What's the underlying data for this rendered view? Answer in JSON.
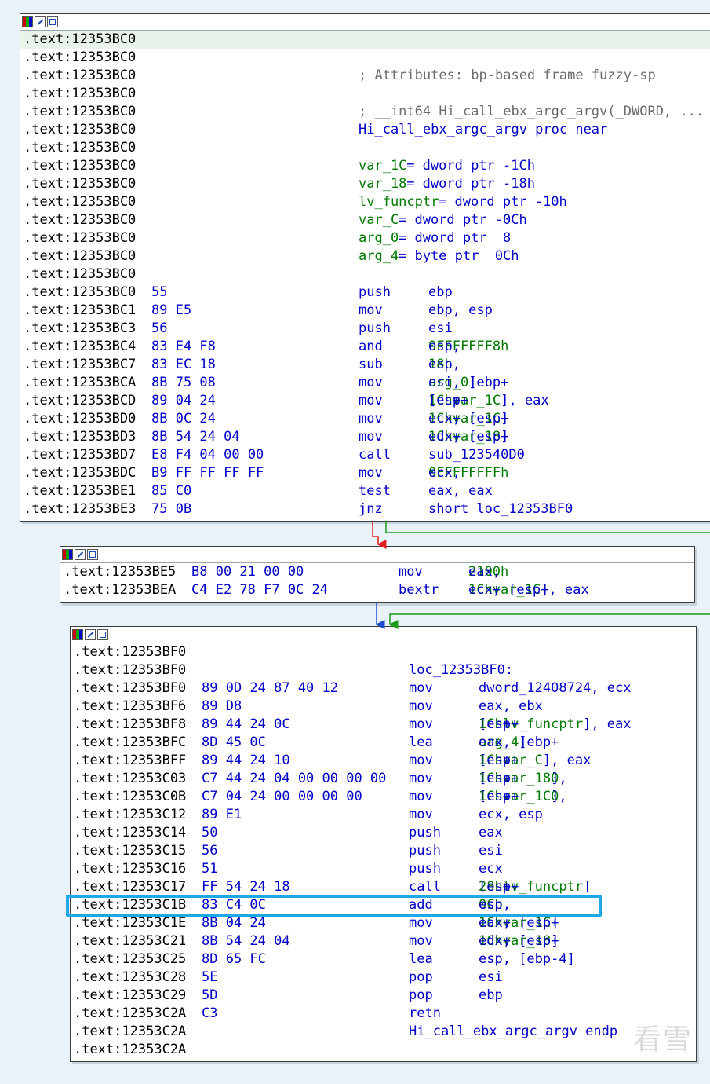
{
  "blocks": [
    {
      "id": "block1",
      "lines": [
        {
          "addr": ".text:12353BC0"
        },
        {
          "addr": ".text:12353BC0"
        },
        {
          "addr": ".text:12353BC0",
          "comment": "; Attributes: bp-based frame fuzzy-sp"
        },
        {
          "addr": ".text:12353BC0"
        },
        {
          "addr": ".text:12353BC0",
          "comment": "; __int64 Hi_call_ebx_argc_argv(_DWORD, ..."
        },
        {
          "addr": ".text:12353BC0",
          "label": "Hi_call_ebx_argc_argv proc near"
        },
        {
          "addr": ".text:12353BC0"
        },
        {
          "addr": ".text:12353BC0",
          "var": "var_1C",
          "vardef": "= dword ptr -1Ch"
        },
        {
          "addr": ".text:12353BC0",
          "var": "var_18",
          "vardef": "= dword ptr -18h"
        },
        {
          "addr": ".text:12353BC0",
          "var": "lv_funcptr",
          "vardef": "= dword ptr -10h"
        },
        {
          "addr": ".text:12353BC0",
          "var": "var_C",
          "vardef": "= dword ptr -0Ch"
        },
        {
          "addr": ".text:12353BC0",
          "var": "arg_0",
          "vardef": "= dword ptr  8"
        },
        {
          "addr": ".text:12353BC0",
          "var": "arg_4",
          "vardef": "= byte ptr  0Ch"
        },
        {
          "addr": ".text:12353BC0"
        },
        {
          "addr": ".text:12353BC0",
          "bytes": "55",
          "mnem": "push",
          "ops": [
            [
              "ebp",
              0
            ]
          ]
        },
        {
          "addr": ".text:12353BC1",
          "bytes": "89 E5",
          "mnem": "mov",
          "ops": [
            [
              "ebp, esp",
              0
            ]
          ]
        },
        {
          "addr": ".text:12353BC3",
          "bytes": "56",
          "mnem": "push",
          "ops": [
            [
              "esi",
              0
            ]
          ]
        },
        {
          "addr": ".text:12353BC4",
          "bytes": "83 E4 F8",
          "mnem": "and",
          "ops": [
            [
              "esp, ",
              0
            ],
            [
              "0FFFFFFF8h",
              1
            ]
          ]
        },
        {
          "addr": ".text:12353BC7",
          "bytes": "83 EC 18",
          "mnem": "sub",
          "ops": [
            [
              "esp, ",
              0
            ],
            [
              "18h",
              1
            ]
          ]
        },
        {
          "addr": ".text:12353BCA",
          "bytes": "8B 75 08",
          "mnem": "mov",
          "ops": [
            [
              "esi, [ebp+",
              0
            ],
            [
              "arg_0",
              1
            ],
            [
              "]",
              0
            ]
          ]
        },
        {
          "addr": ".text:12353BCD",
          "bytes": "89 04 24",
          "mnem": "mov",
          "ops": [
            [
              "[esp+",
              0
            ],
            [
              "1Ch",
              1
            ],
            [
              "+",
              0
            ],
            [
              "var_1C",
              1
            ],
            [
              "], eax",
              0
            ]
          ]
        },
        {
          "addr": ".text:12353BD0",
          "bytes": "8B 0C 24",
          "mnem": "mov",
          "ops": [
            [
              "ecx, [esp+",
              0
            ],
            [
              "1Ch",
              1
            ],
            [
              "+",
              0
            ],
            [
              "var_1C",
              1
            ],
            [
              "]",
              0
            ]
          ]
        },
        {
          "addr": ".text:12353BD3",
          "bytes": "8B 54 24 04",
          "mnem": "mov",
          "ops": [
            [
              "edx, [esp+",
              0
            ],
            [
              "1Ch",
              1
            ],
            [
              "+",
              0
            ],
            [
              "var_18",
              1
            ],
            [
              "]",
              0
            ]
          ]
        },
        {
          "addr": ".text:12353BD7",
          "bytes": "E8 F4 04 00 00",
          "mnem": "call",
          "ops": [
            [
              "sub_123540D0",
              0
            ]
          ]
        },
        {
          "addr": ".text:12353BDC",
          "bytes": "B9 FF FF FF FF",
          "mnem": "mov",
          "ops": [
            [
              "ecx, ",
              0
            ],
            [
              "0FFFFFFFFh",
              1
            ]
          ]
        },
        {
          "addr": ".text:12353BE1",
          "bytes": "85 C0",
          "mnem": "test",
          "ops": [
            [
              "eax, eax",
              0
            ]
          ]
        },
        {
          "addr": ".text:12353BE3",
          "bytes": "75 0B",
          "mnem": "jnz",
          "ops": [
            [
              "short loc_12353BF0",
              0
            ]
          ]
        }
      ]
    },
    {
      "id": "block2",
      "lines": [
        {
          "addr": ".text:12353BE5",
          "bytes": "B8 00 21 00 00",
          "mnem": "mov",
          "ops": [
            [
              "eax, ",
              0
            ],
            [
              "2100h",
              1
            ]
          ]
        },
        {
          "addr": ".text:12353BEA",
          "bytes": "C4 E2 78 F7 0C 24",
          "mnem": "bextr",
          "ops": [
            [
              "ecx, [esp+",
              0
            ],
            [
              "1Ch",
              1
            ],
            [
              "+",
              0
            ],
            [
              "var_1C",
              1
            ],
            [
              "], eax",
              0
            ]
          ]
        }
      ]
    },
    {
      "id": "block3",
      "lines": [
        {
          "addr": ".text:12353BF0"
        },
        {
          "addr": ".text:12353BF0",
          "label": "loc_12353BF0:"
        },
        {
          "addr": ".text:12353BF0",
          "bytes": "89 0D 24 87 40 12",
          "mnem": "mov",
          "ops": [
            [
              "dword_12408724, ecx",
              0
            ]
          ]
        },
        {
          "addr": ".text:12353BF6",
          "bytes": "89 D8",
          "mnem": "mov",
          "ops": [
            [
              "eax, ebx",
              0
            ]
          ]
        },
        {
          "addr": ".text:12353BF8",
          "bytes": "89 44 24 0C",
          "mnem": "mov",
          "ops": [
            [
              "[esp+",
              0
            ],
            [
              "1Ch",
              1
            ],
            [
              "+",
              0
            ],
            [
              "lv_funcptr",
              1
            ],
            [
              "], eax",
              0
            ]
          ]
        },
        {
          "addr": ".text:12353BFC",
          "bytes": "8D 45 0C",
          "mnem": "lea",
          "ops": [
            [
              "eax, [ebp+",
              0
            ],
            [
              "arg_4",
              1
            ],
            [
              "]",
              0
            ]
          ]
        },
        {
          "addr": ".text:12353BFF",
          "bytes": "89 44 24 10",
          "mnem": "mov",
          "ops": [
            [
              "[esp+",
              0
            ],
            [
              "1Ch",
              1
            ],
            [
              "+",
              0
            ],
            [
              "var_C",
              1
            ],
            [
              "], eax",
              0
            ]
          ]
        },
        {
          "addr": ".text:12353C03",
          "bytes": "C7 44 24 04 00 00 00 00",
          "mnem": "mov",
          "ops": [
            [
              "[esp+",
              0
            ],
            [
              "1Ch",
              1
            ],
            [
              "+",
              0
            ],
            [
              "var_18",
              1
            ],
            [
              "], ",
              0
            ],
            [
              "0",
              1
            ]
          ]
        },
        {
          "addr": ".text:12353C0B",
          "bytes": "C7 04 24 00 00 00 00",
          "mnem": "mov",
          "ops": [
            [
              "[esp+",
              0
            ],
            [
              "1Ch",
              1
            ],
            [
              "+",
              0
            ],
            [
              "var_1C",
              1
            ],
            [
              "], ",
              0
            ],
            [
              "0",
              1
            ]
          ]
        },
        {
          "addr": ".text:12353C12",
          "bytes": "89 E1",
          "mnem": "mov",
          "ops": [
            [
              "ecx, esp",
              0
            ]
          ]
        },
        {
          "addr": ".text:12353C14",
          "bytes": "50",
          "mnem": "push",
          "ops": [
            [
              "eax",
              0
            ]
          ]
        },
        {
          "addr": ".text:12353C15",
          "bytes": "56",
          "mnem": "push",
          "ops": [
            [
              "esi",
              0
            ]
          ]
        },
        {
          "addr": ".text:12353C16",
          "bytes": "51",
          "mnem": "push",
          "ops": [
            [
              "ecx",
              0
            ]
          ]
        },
        {
          "addr": ".text:12353C17",
          "bytes": "FF 54 24 18",
          "mnem": "call",
          "ops": [
            [
              "[esp+",
              0
            ],
            [
              "28h",
              1
            ],
            [
              "+",
              0
            ],
            [
              "lv_funcptr",
              1
            ],
            [
              "]",
              0
            ]
          ]
        },
        {
          "addr": ".text:12353C1B",
          "bytes": "83 C4 0C",
          "mnem": "add",
          "ops": [
            [
              "esp, ",
              0
            ],
            [
              "0Ch",
              1
            ]
          ]
        },
        {
          "addr": ".text:12353C1E",
          "bytes": "8B 04 24",
          "mnem": "mov",
          "ops": [
            [
              "eax, [esp+",
              0
            ],
            [
              "1Ch",
              1
            ],
            [
              "+",
              0
            ],
            [
              "var_1C",
              1
            ],
            [
              "]",
              0
            ]
          ]
        },
        {
          "addr": ".text:12353C21",
          "bytes": "8B 54 24 04",
          "mnem": "mov",
          "ops": [
            [
              "edx, [esp+",
              0
            ],
            [
              "1Ch",
              1
            ],
            [
              "+",
              0
            ],
            [
              "var_18",
              1
            ],
            [
              "]",
              0
            ]
          ]
        },
        {
          "addr": ".text:12353C25",
          "bytes": "8D 65 FC",
          "mnem": "lea",
          "ops": [
            [
              "esp, [ebp-4]",
              0
            ]
          ]
        },
        {
          "addr": ".text:12353C28",
          "bytes": "5E",
          "mnem": "pop",
          "ops": [
            [
              "esi",
              0
            ]
          ]
        },
        {
          "addr": ".text:12353C29",
          "bytes": "5D",
          "mnem": "pop",
          "ops": [
            [
              "ebp",
              0
            ]
          ]
        },
        {
          "addr": ".text:12353C2A",
          "bytes": "C3",
          "mnem": "retn",
          "ops": []
        },
        {
          "addr": ".text:12353C2A",
          "label": "Hi_call_ebx_argc_argv endp"
        },
        {
          "addr": ".text:12353C2A"
        }
      ]
    }
  ],
  "watermark": "看雪",
  "colors": {
    "blue": "#0000c8",
    "green": "#007a00",
    "comment": "#6c6c6c",
    "edge_false": "#e02020",
    "edge_true": "#1a9a1a",
    "edge_uncond": "#1b4fd0",
    "selection": "#1ea8e8"
  }
}
